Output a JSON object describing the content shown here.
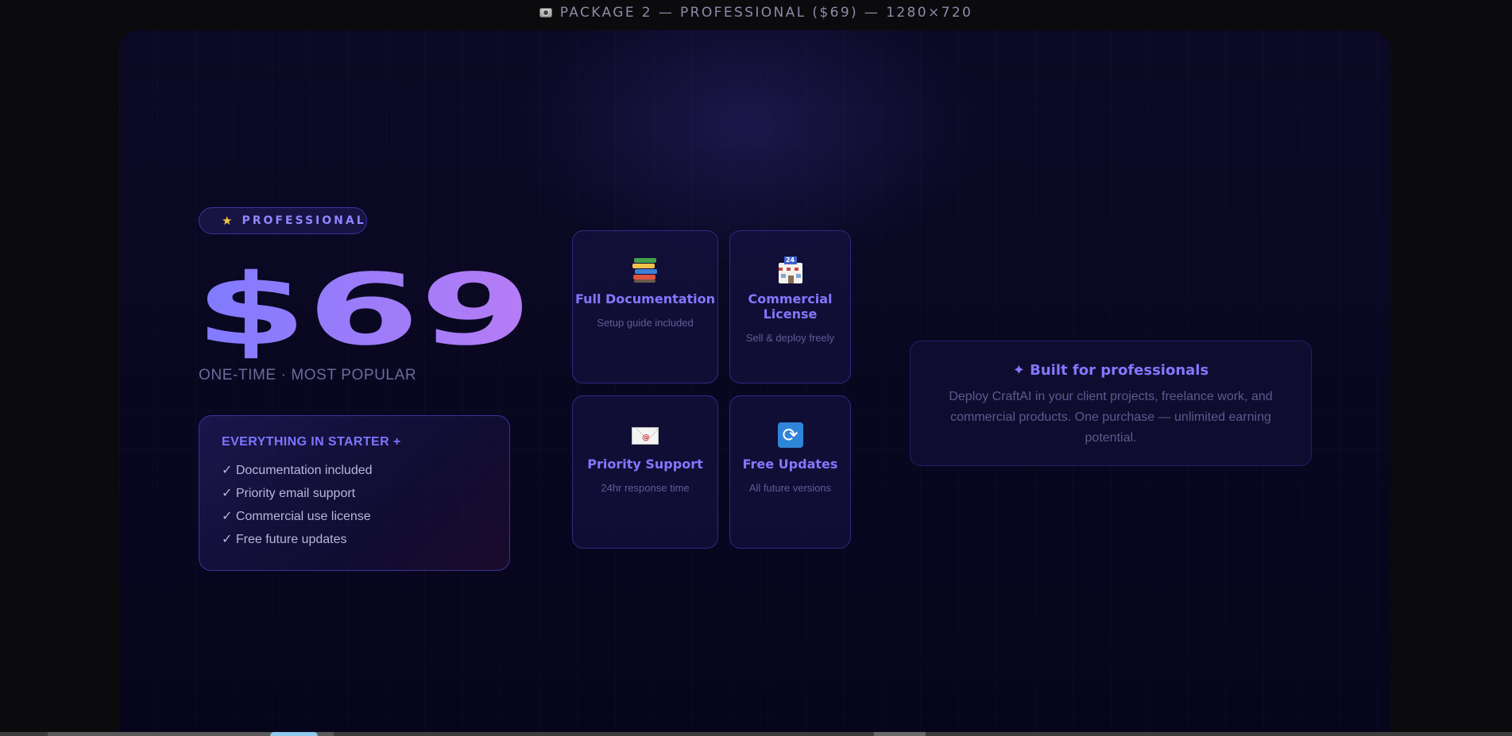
{
  "topbar": {
    "icon": "camera-icon",
    "label": "PACKAGE 2 — PROFESSIONAL ($69) — 1280×720"
  },
  "plan": {
    "badge": {
      "icon": "★",
      "label": "PROFESSIONAL"
    },
    "price": "$69",
    "price_gradient": [
      "#7f7bff",
      "#b77cf5"
    ],
    "subtitle": "ONE-TIME · MOST POPULAR",
    "starter": {
      "heading": "EVERYTHING IN STARTER +",
      "items": [
        "✓ Documentation included",
        "✓ Priority email support",
        "✓ Commercial use license",
        "✓ Free future updates"
      ]
    }
  },
  "features": [
    {
      "icon": "books-icon",
      "title": "Full Documentation",
      "desc": "Setup guide included"
    },
    {
      "icon": "store-24-icon",
      "sign": "24",
      "title": "Commercial License",
      "desc": "Sell & deploy freely"
    },
    {
      "icon": "envelope-icon",
      "title": "Priority Support",
      "desc": "24hr response time"
    },
    {
      "icon": "refresh-icon",
      "title": "Free Updates",
      "desc": "All future versions"
    }
  ],
  "professional": {
    "title": "✦ Built for professionals",
    "body": "Deploy CraftAI in your client projects, freelance work, and commercial products. One purchase — unlimited earning potential."
  },
  "colors": {
    "accent": "#8377ff",
    "background": "#0b0925",
    "muted": "#5f5c96",
    "star": "#f5c542"
  }
}
